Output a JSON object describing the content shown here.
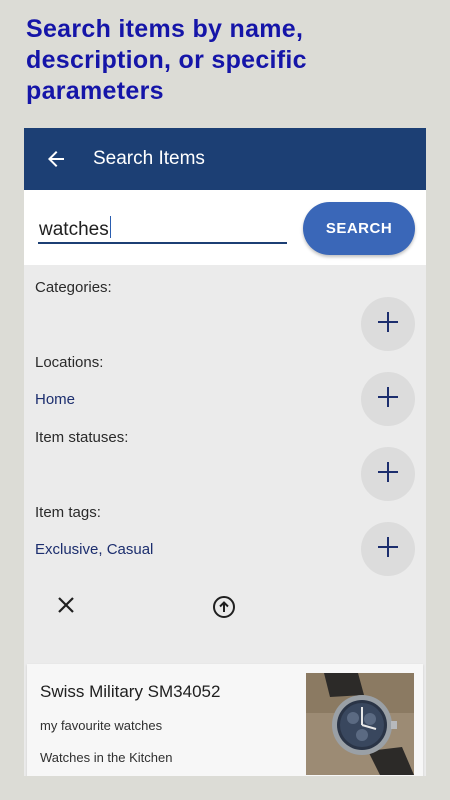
{
  "promo": {
    "lines": [
      "Search items by name,",
      "description, or specific",
      "parameters"
    ]
  },
  "appbar": {
    "title": "Search Items",
    "back_icon": "arrow-back-icon"
  },
  "search": {
    "value": "watches",
    "button_label": "SEARCH"
  },
  "filters": {
    "categories": {
      "label": "Categories:",
      "value": ""
    },
    "locations": {
      "label": "Locations:",
      "value": "Home"
    },
    "statuses": {
      "label": "Item statuses:",
      "value": ""
    },
    "tags": {
      "label": "Item tags:",
      "value": "Exclusive, Casual"
    },
    "add_icon": "plus-icon"
  },
  "actions": {
    "clear_icon": "close-icon",
    "upload_icon": "arrow-up-circle-icon"
  },
  "results": [
    {
      "title": "Swiss Military SM34052",
      "description": "my favourite watches",
      "location": "Watches in the Kitchen",
      "thumbnail": "watch-photo"
    }
  ],
  "colors": {
    "promo_text": "#1515a8",
    "appbar": "#1c3f74",
    "button": "#3a67b8",
    "link_value": "#1c2e6e",
    "background": "#dcdcd6"
  }
}
